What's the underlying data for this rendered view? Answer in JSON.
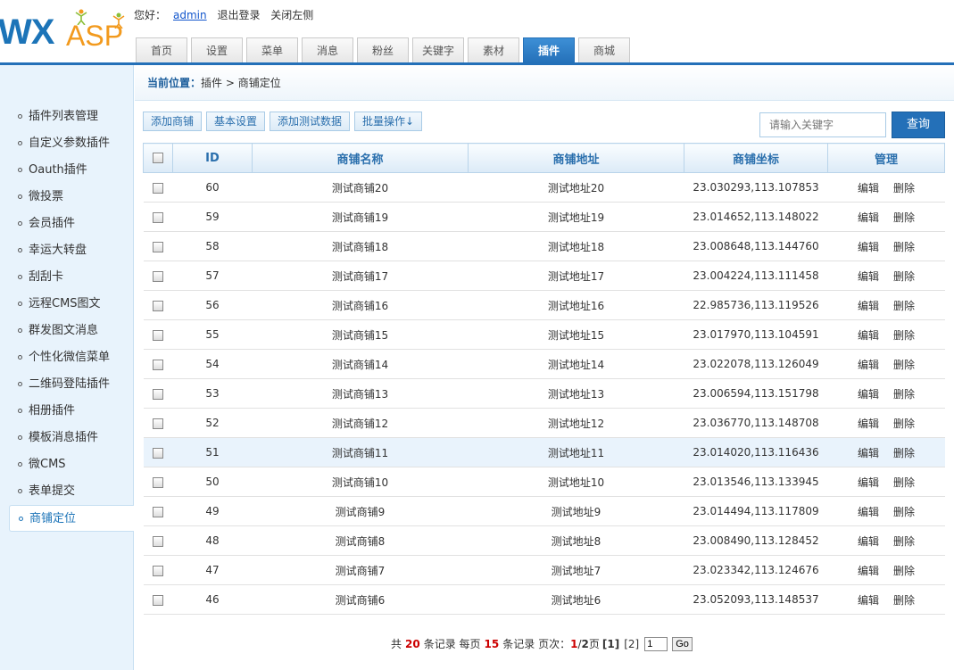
{
  "header": {
    "logo_wx": "WX",
    "logo_asp": "ASP",
    "greeting": "您好：",
    "user": "admin",
    "logout": "退出登录",
    "close_left": "关闭左侧"
  },
  "nav": {
    "tabs": [
      "首页",
      "设置",
      "菜单",
      "消息",
      "粉丝",
      "关键字",
      "素材",
      "插件",
      "商城"
    ],
    "active": "插件"
  },
  "sidebar": {
    "items": [
      "插件列表管理",
      "自定义参数插件",
      "Oauth插件",
      "微投票",
      "会员插件",
      "幸运大转盘",
      "刮刮卡",
      "远程CMS图文",
      "群发图文消息",
      "个性化微信菜单",
      "二维码登陆插件",
      "相册插件",
      "模板消息插件",
      "微CMS",
      "表单提交",
      "商铺定位"
    ],
    "active": "商铺定位"
  },
  "breadcrumb": {
    "label": "当前位置：",
    "path": "插件 > 商铺定位"
  },
  "toolbar": {
    "add": "添加商铺",
    "settings": "基本设置",
    "add_test": "添加测试数据",
    "batch": "批量操作↓"
  },
  "search": {
    "placeholder": "请输入关键字",
    "button": "查询"
  },
  "table": {
    "columns": [
      "ID",
      "商铺名称",
      "商铺地址",
      "商铺坐标",
      "管理"
    ],
    "actions": {
      "edit": "编辑",
      "delete": "删除"
    },
    "rows": [
      {
        "id": "60",
        "name": "测试商铺20",
        "addr": "测试地址20",
        "coord": "23.030293,113.107853"
      },
      {
        "id": "59",
        "name": "测试商铺19",
        "addr": "测试地址19",
        "coord": "23.014652,113.148022"
      },
      {
        "id": "58",
        "name": "测试商铺18",
        "addr": "测试地址18",
        "coord": "23.008648,113.144760"
      },
      {
        "id": "57",
        "name": "测试商铺17",
        "addr": "测试地址17",
        "coord": "23.004224,113.111458"
      },
      {
        "id": "56",
        "name": "测试商铺16",
        "addr": "测试地址16",
        "coord": "22.985736,113.119526"
      },
      {
        "id": "55",
        "name": "测试商铺15",
        "addr": "测试地址15",
        "coord": "23.017970,113.104591"
      },
      {
        "id": "54",
        "name": "测试商铺14",
        "addr": "测试地址14",
        "coord": "23.022078,113.126049"
      },
      {
        "id": "53",
        "name": "测试商铺13",
        "addr": "测试地址13",
        "coord": "23.006594,113.151798"
      },
      {
        "id": "52",
        "name": "测试商铺12",
        "addr": "测试地址12",
        "coord": "23.036770,113.148708"
      },
      {
        "id": "51",
        "name": "测试商铺11",
        "addr": "测试地址11",
        "coord": "23.014020,113.116436",
        "highlight": true
      },
      {
        "id": "50",
        "name": "测试商铺10",
        "addr": "测试地址10",
        "coord": "23.013546,113.133945"
      },
      {
        "id": "49",
        "name": "测试商铺9",
        "addr": "测试地址9",
        "coord": "23.014494,113.117809"
      },
      {
        "id": "48",
        "name": "测试商铺8",
        "addr": "测试地址8",
        "coord": "23.008490,113.128452"
      },
      {
        "id": "47",
        "name": "测试商铺7",
        "addr": "测试地址7",
        "coord": "23.023342,113.124676"
      },
      {
        "id": "46",
        "name": "测试商铺6",
        "addr": "测试地址6",
        "coord": "23.052093,113.148537"
      }
    ]
  },
  "pager": {
    "t1": "共",
    "total": "20",
    "t2": "条记录 每页",
    "per": "15",
    "t3": "条记录 页次：",
    "current": "1",
    "sep": "/",
    "pages": "2",
    "t4": "页",
    "page1": "[1]",
    "page2": "[2]",
    "input": "1",
    "go": "Go"
  },
  "colors": {
    "accent": "#2470b8",
    "sidebar_bg": "#e8f3fc",
    "highlight_row": "#e9f3fc",
    "emphasis": "#cc0000"
  }
}
